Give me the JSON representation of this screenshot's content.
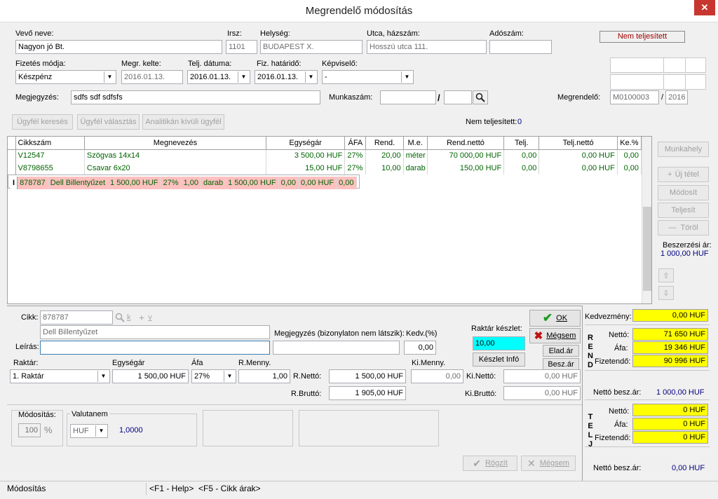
{
  "window": {
    "title": "Megrendelő módosítás",
    "close": "✕"
  },
  "header": {
    "vevo_label": "Vevő neve:",
    "vevo_value": "Nagyon jó Bt.",
    "irsz_label": "Irsz:",
    "irsz_value": "1101",
    "helyseg_label": "Helység:",
    "helyseg_value": "BUDAPEST X.",
    "utca_label": "Utca, házszám:",
    "utca_value": "Hosszú utca 111.",
    "adoszam_label": "Adószám:",
    "adoszam_value": "",
    "status_badge": "Nem teljesített",
    "fizmod_label": "Fizetés módja:",
    "fizmod_value": "Készpénz",
    "kelte_label": "Megr. kelte:",
    "kelte_value": "2016.01.13.",
    "teljdat_label": "Telj. dátuma:",
    "teljdat_value": "2016.01.13.",
    "fizhat_label": "Fiz. határidő:",
    "fizhat_value": "2016.01.13.",
    "kepviselo_label": "Képviselő:",
    "kepviselo_value": "-",
    "megj_label": "Megjegyzés:",
    "megj_value": "sdfs sdf sdfsfs",
    "munkaszam_label": "Munkaszám:",
    "munkaszam_sep": "/",
    "megrendelo_label": "Megrendelő:",
    "megrendelo_value": "M0100003",
    "megrendelo_sep": "/",
    "megrendelo_year": "2016"
  },
  "actions": {
    "ugyfel_kereses": "Ügyfél keresés",
    "ugyfel_valasztas": "Ügyfél választás",
    "analitikan": "Analitikán kívüli ügyfél",
    "nem_telj_label": "Nem teljesített:",
    "nem_telj_value": "0"
  },
  "table": {
    "columns": [
      "Cikkszám",
      "Megnevezés",
      "Egységár",
      "ÁFA",
      "Rend.",
      "M.e.",
      "Rend.nettó",
      "Telj.",
      "Telj.nettó",
      "Ke.%"
    ],
    "rows": [
      [
        "V12547",
        "Szögvas 14x14",
        "3 500,00 HUF",
        "27%",
        "20,00",
        "méter",
        "70 000,00 HUF",
        "0,00",
        "0,00 HUF",
        "0,00"
      ],
      [
        "V8798655",
        "Csavar 6x20",
        "15,00 HUF",
        "27%",
        "10,00",
        "darab",
        "150,00 HUF",
        "0,00",
        "0,00 HUF",
        "0,00"
      ],
      [
        "878787",
        "Dell Billentyűzet",
        "1 500,00 HUF",
        "27%",
        "1,00",
        "darab",
        "1 500,00 HUF",
        "0,00",
        "0,00 HUF",
        "0,00"
      ]
    ]
  },
  "side": {
    "munkahely": "Munkahely",
    "uj_tetel": "Új tétel",
    "modosit": "Módosít",
    "teljesit": "Teljesít",
    "torol": "Töröl",
    "beszerzesi_label": "Beszerzési ár:",
    "beszerzesi_value": "1 000,00 HUF"
  },
  "detail": {
    "cikk_label": "Cikk:",
    "cikk_value": "878787",
    "k_label": "k",
    "v_label": "v",
    "cikk_name": "Dell Billentyűzet",
    "leiras_label": "Leírás:",
    "megj_label": "Megjegyzés (bizonylaton nem látszik):",
    "kedv_label": "Kedv.(%)",
    "kedv_value": "0,00",
    "raktar_keszlet_label": "Raktár készlet:",
    "raktar_keszlet_value": "10,00",
    "keszlet_info": "Készlet Infó",
    "ok": "OK",
    "megsem": "Mégsem",
    "elad_ar": "Elad.ár",
    "besz_ar": "Besz.ár",
    "raktar_label": "Raktár:",
    "raktar_value": "1. Raktár",
    "egysegar_label": "Egységár",
    "egysegar_value": "1 500,00 HUF",
    "afa_label": "Áfa",
    "afa_value": "27%",
    "rmenny_label": "R.Menny.",
    "rmenny_value": "1,00",
    "kimenny_label": "Ki.Menny.",
    "kimenny_value": "0,00",
    "rnetto_label": "R.Nettó:",
    "rnetto_value": "1 500,00 HUF",
    "kinetto_label": "Ki.Nettó:",
    "kinetto_value": "0,00 HUF",
    "rbrutto_label": "R.Bruttó:",
    "rbrutto_value": "1 905,00 HUF",
    "kibrutto_label": "Ki.Bruttó:",
    "kibrutto_value": "0,00 HUF"
  },
  "bottom": {
    "modositas_label": "Módosítás:",
    "modositas_value": "100",
    "pct": "%",
    "valutanem_label": "Valutanem",
    "valutanem_value": "HUF",
    "arfolyam": "1,0000",
    "rogzit": "Rögzít",
    "megsem": "Mégsem"
  },
  "summary": {
    "kedv_label": "Kedvezmény:",
    "kedv_value": "0,00 HUF",
    "rend_letters": [
      "R",
      "E",
      "N",
      "D"
    ],
    "rend_netto_label": "Nettó:",
    "rend_netto": "71 650 HUF",
    "rend_afa_label": "Áfa:",
    "rend_afa": "19 346 HUF",
    "rend_fiz_label": "Fizetendő:",
    "rend_fiz": "90 996 HUF",
    "netto_besz_label": "Nettó besz.ár:",
    "netto_besz_value": "1 000,00 HUF",
    "telj_letters": [
      "T",
      "E",
      "L",
      "J"
    ],
    "telj_netto_label": "Nettó:",
    "telj_netto": "0 HUF",
    "telj_afa_label": "Áfa:",
    "telj_afa": "0 HUF",
    "telj_fiz_label": "Fizetendő:",
    "telj_fiz": "0 HUF",
    "netto_besz2_label": "Nettó besz.ár:",
    "netto_besz2_value": "0,00 HUF"
  },
  "statusbar": {
    "mode": "Módosítás",
    "help": "<F1 - Help>",
    "f5": "<F5 - Cikk árak>"
  }
}
